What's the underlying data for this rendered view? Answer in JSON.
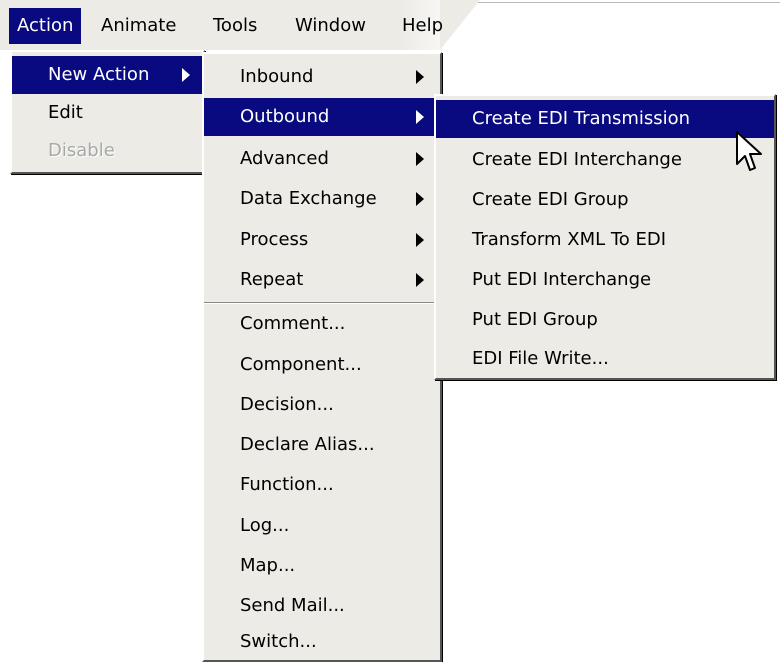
{
  "menubar": {
    "items": [
      {
        "label": "Action"
      },
      {
        "label": "Animate"
      },
      {
        "label": "Tools"
      },
      {
        "label": "Window"
      },
      {
        "label": "Help"
      }
    ]
  },
  "action_menu": {
    "items": [
      {
        "label": "New Action"
      },
      {
        "label": "Edit"
      },
      {
        "label": "Disable"
      }
    ]
  },
  "new_action_menu": {
    "items": [
      {
        "label": "Inbound"
      },
      {
        "label": "Outbound"
      },
      {
        "label": "Advanced"
      },
      {
        "label": "Data Exchange"
      },
      {
        "label": "Process"
      },
      {
        "label": "Repeat"
      },
      {
        "label": "Comment..."
      },
      {
        "label": "Component..."
      },
      {
        "label": "Decision..."
      },
      {
        "label": "Declare Alias..."
      },
      {
        "label": "Function..."
      },
      {
        "label": "Log..."
      },
      {
        "label": "Map..."
      },
      {
        "label": "Send Mail..."
      },
      {
        "label": "Switch..."
      }
    ]
  },
  "outbound_menu": {
    "items": [
      {
        "label": "Create EDI Transmission"
      },
      {
        "label": "Create EDI Interchange"
      },
      {
        "label": "Create EDI Group"
      },
      {
        "label": "Transform XML To EDI"
      },
      {
        "label": "Put EDI Interchange"
      },
      {
        "label": "Put EDI Group"
      },
      {
        "label": "EDI File Write..."
      }
    ]
  },
  "colors": {
    "menu_bg": "#ecebe6",
    "highlight": "#0a0a80",
    "disabled_text": "#a8a8a8"
  },
  "icons": {
    "cursor": "mouse-pointer-icon",
    "submenu": "submenu-arrow-icon"
  }
}
